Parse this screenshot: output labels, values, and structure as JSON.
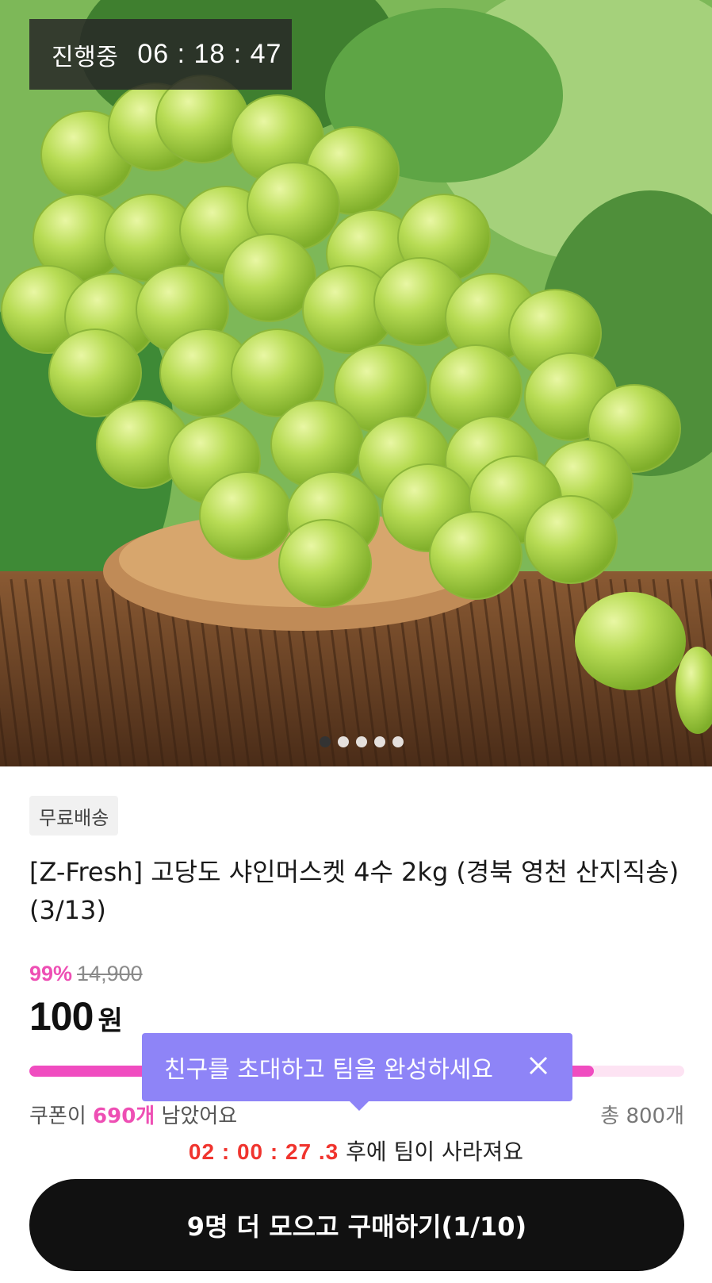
{
  "hero": {
    "live_status": "진행중",
    "live_timer": "06 : 18 : 47",
    "image_label": "shine-muscat-grapes-photo",
    "carousel": {
      "count": 5,
      "active_index": 0
    }
  },
  "product": {
    "shipping_badge": "무료배송",
    "title": "[Z-Fresh] 고당도 샤인머스켓 4수 2kg (경북 영천 산지직송) (3/13)",
    "discount_rate": "99%",
    "original_price": "14,900",
    "final_price": "100",
    "price_unit": "원"
  },
  "coupon": {
    "prefix": "쿠폰이 ",
    "remaining": "690개",
    "suffix": " 남았어요",
    "total": "총 800개",
    "progress_fraction": 0.8625
  },
  "tooltip": {
    "message": "친구를 초대하고 팀을 완성하세요"
  },
  "team": {
    "timer": "02 : 00 : 27 .3",
    "suffix": " 후에 팀이 사라져요"
  },
  "cta": {
    "label": "9명 더 모으고 구매하기(1/10)"
  },
  "colors": {
    "accent_pink": "#ee4fb4",
    "tooltip_purple": "#8e84f7",
    "timer_red": "#f0342e",
    "cta_black": "#111111"
  }
}
